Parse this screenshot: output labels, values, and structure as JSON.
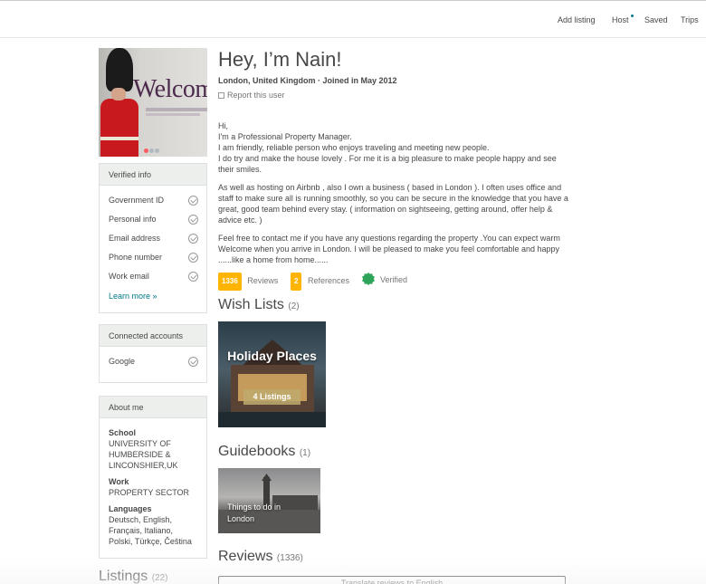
{
  "nav": {
    "items": [
      {
        "label": "Add listing"
      },
      {
        "label": "Host"
      },
      {
        "label": "Saved"
      },
      {
        "label": "Trips"
      }
    ]
  },
  "profile": {
    "photo_sign_text": "Welcom",
    "greeting": "Hey, I’m Nain!",
    "subline": "London, United Kingdom · Joined in May 2012",
    "report_link": "Report this user",
    "bio": [
      "Hi,\nI'm a Professional Property Manager.\nI am friendly, reliable person who enjoys traveling and meeting new people.\nI do try and make the house lovely . For me it is a big pleasure to make people happy and see their smiles.",
      "As well as hosting on Airbnb , also I own a business ( based in London ). I often uses office and staff to make sure all is running smoothly, so you can be secure in the knowledge that you have a great, good team behind every stay. ( information on sightseeing, getting around, offer help & advice etc. )",
      "Feel free to contact me if you have any questions regarding the property .You can expect warm Welcome when you arrive in London. I will be pleased to make you feel comfortable and happy ......like a home from home......"
    ],
    "stats": {
      "reviews_count": "1336",
      "reviews_label": "Reviews",
      "references_count": "2",
      "references_label": "References",
      "verified_label": "Verified"
    }
  },
  "verified_info": {
    "heading": "Verified info",
    "items": [
      "Government ID",
      "Personal info",
      "Email address",
      "Phone number",
      "Work email"
    ],
    "learn_more": "Learn more »"
  },
  "connected_accounts": {
    "heading": "Connected accounts",
    "items": [
      "Google"
    ]
  },
  "about_me": {
    "heading": "About me",
    "school_label": "School",
    "school_value": "UNIVERSITY OF HUMBERSIDE & LINCONSHIER,UK",
    "work_label": "Work",
    "work_value": "PROPERTY SECTOR",
    "languages_label": "Languages",
    "languages_value": "Deutsch, English, Français, Italiano, Polski, Türkçe, Čeština"
  },
  "wish_lists": {
    "heading": "Wish Lists",
    "count": "(2)",
    "card_title": "Holiday Places",
    "card_listings": "4 Listings"
  },
  "guidebooks": {
    "heading": "Guidebooks",
    "count": "(1)",
    "card_title": "Things to do in London"
  },
  "reviews": {
    "heading": "Reviews",
    "count": "(1336)",
    "translate_button": "Translate reviews to English"
  },
  "listings": {
    "heading": "Listings",
    "count": "(22)"
  },
  "colors": {
    "accent": "#007a87",
    "badge": "#ffb400",
    "verified": "#2ea35a",
    "coat_red": "#c8191f"
  }
}
